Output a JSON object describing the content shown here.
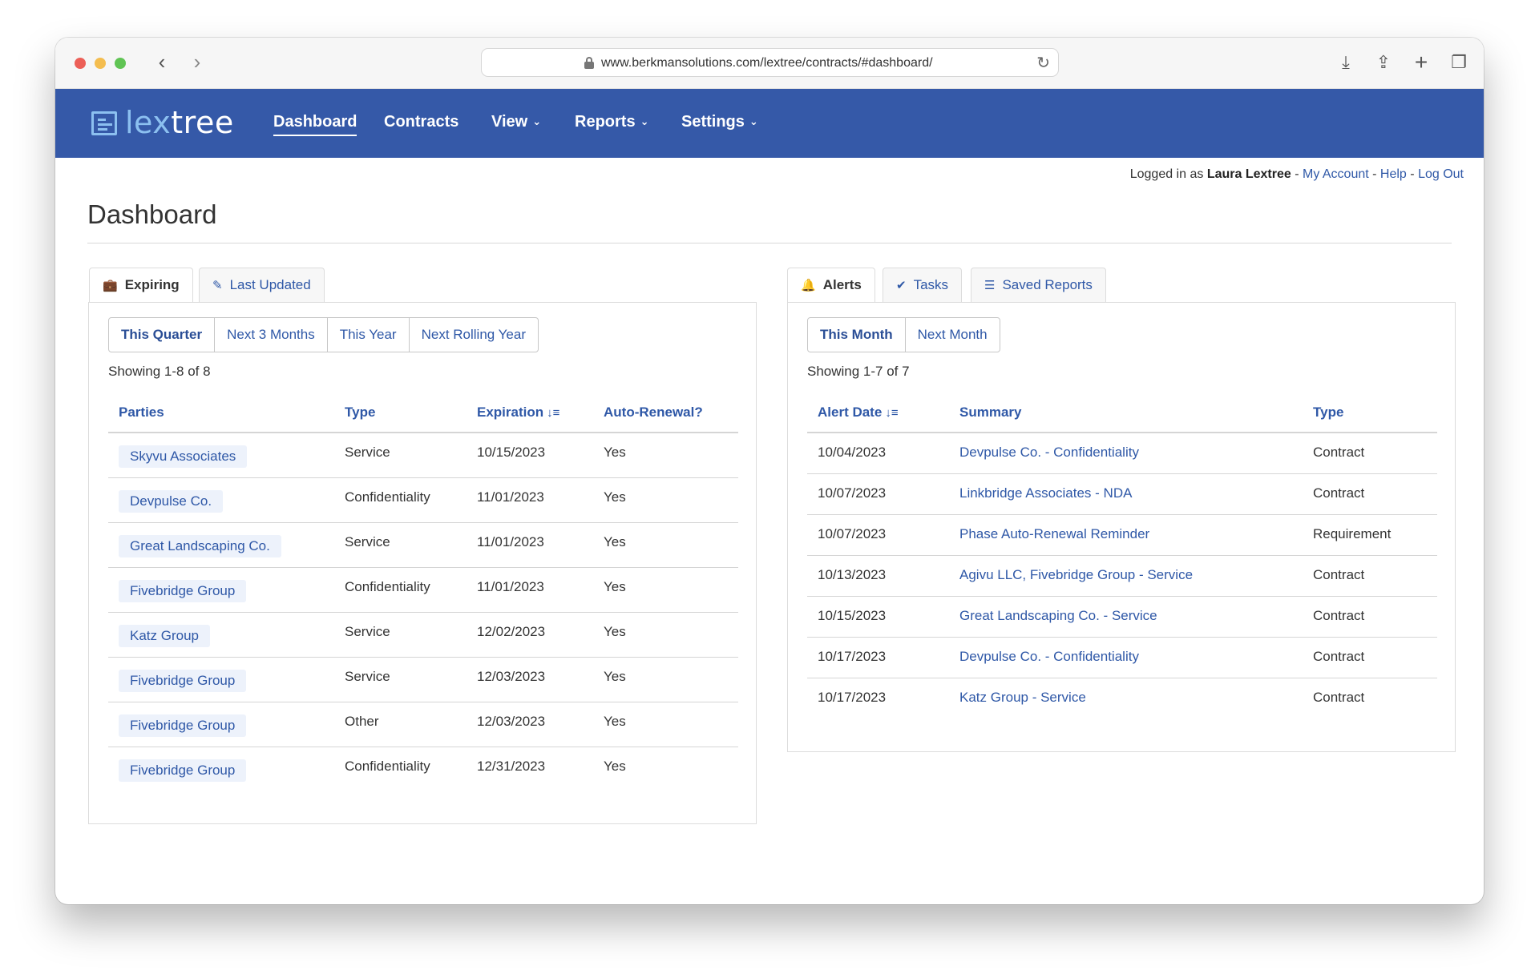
{
  "browser": {
    "url": "www.berkmansolutions.com/lextree/contracts/#dashboard/"
  },
  "app": {
    "logo_text_a": "lex",
    "logo_text_b": "tree",
    "nav": [
      {
        "label": "Dashboard"
      },
      {
        "label": "Contracts"
      },
      {
        "label": "View"
      },
      {
        "label": "Reports"
      },
      {
        "label": "Settings"
      }
    ]
  },
  "user": {
    "prefix": "Logged in as",
    "name": "Laura Lextree",
    "my_account": "My Account",
    "help": "Help",
    "logout": "Log Out",
    "sep": "-"
  },
  "page": {
    "title": "Dashboard"
  },
  "left": {
    "tabs": [
      {
        "label": "Expiring",
        "icon": "briefcase-icon"
      },
      {
        "label": "Last Updated",
        "icon": "pencil-icon"
      }
    ],
    "filters": [
      "This Quarter",
      "Next 3 Months",
      "This Year",
      "Next Rolling Year"
    ],
    "showing": "Showing 1-8 of 8",
    "columns": [
      "Parties",
      "Type",
      "Expiration",
      "Auto-Renewal?"
    ],
    "rows": [
      {
        "party": "Skyvu Associates",
        "type": "Service",
        "expiration": "10/15/2023",
        "auto": "Yes"
      },
      {
        "party": "Devpulse Co.",
        "type": "Confidentiality",
        "expiration": "11/01/2023",
        "auto": "Yes"
      },
      {
        "party": "Great Landscaping Co.",
        "type": "Service",
        "expiration": "11/01/2023",
        "auto": "Yes"
      },
      {
        "party": "Fivebridge Group",
        "type": "Confidentiality",
        "expiration": "11/01/2023",
        "auto": "Yes"
      },
      {
        "party": "Katz Group",
        "type": "Service",
        "expiration": "12/02/2023",
        "auto": "Yes"
      },
      {
        "party": "Fivebridge Group",
        "type": "Service",
        "expiration": "12/03/2023",
        "auto": "Yes"
      },
      {
        "party": "Fivebridge Group",
        "type": "Other",
        "expiration": "12/03/2023",
        "auto": "Yes"
      },
      {
        "party": "Fivebridge Group",
        "type": "Confidentiality",
        "expiration": "12/31/2023",
        "auto": "Yes"
      }
    ]
  },
  "right": {
    "tabs": [
      {
        "label": "Alerts",
        "icon": "bell-icon"
      },
      {
        "label": "Tasks",
        "icon": "check-circle-icon"
      },
      {
        "label": "Saved Reports",
        "icon": "list-icon"
      }
    ],
    "filters": [
      "This Month",
      "Next Month"
    ],
    "showing": "Showing 1-7 of 7",
    "columns": [
      "Alert Date",
      "Summary",
      "Type"
    ],
    "rows": [
      {
        "date": "10/04/2023",
        "summary": "Devpulse Co. - Confidentiality",
        "type": "Contract"
      },
      {
        "date": "10/07/2023",
        "summary": "Linkbridge Associates - NDA",
        "type": "Contract"
      },
      {
        "date": "10/07/2023",
        "summary": "Phase Auto-Renewal Reminder",
        "type": "Requirement"
      },
      {
        "date": "10/13/2023",
        "summary": "Agivu LLC, Fivebridge Group - Service",
        "type": "Contract"
      },
      {
        "date": "10/15/2023",
        "summary": "Great Landscaping Co. - Service",
        "type": "Contract"
      },
      {
        "date": "10/17/2023",
        "summary": "Devpulse Co. - Confidentiality",
        "type": "Contract"
      },
      {
        "date": "10/17/2023",
        "summary": "Katz Group - Service",
        "type": "Contract"
      }
    ]
  },
  "colors": {
    "brand": "#3559a8",
    "link": "#2f58a7",
    "logo_accent": "#8cc0f0"
  }
}
